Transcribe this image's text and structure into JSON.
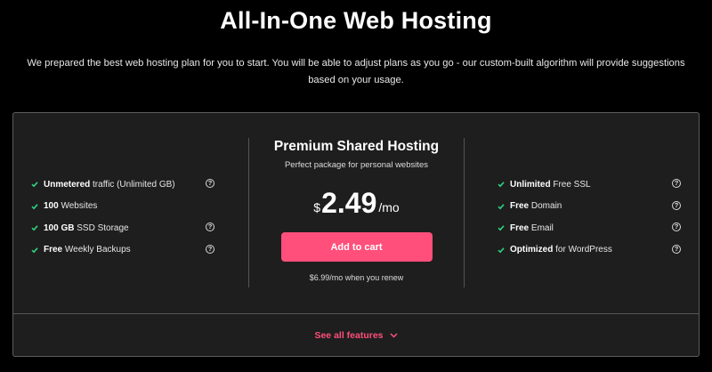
{
  "header": {
    "title": "All-In-One Web Hosting",
    "subtitle": "We prepared the best web hosting plan for you to start. You will be able to adjust plans as you go - our custom-built algorithm will provide suggestions based on your usage."
  },
  "plan": {
    "name": "Premium Shared Hosting",
    "description": "Perfect package for personal websites",
    "currency": "$",
    "price": "2.49",
    "period": "/mo",
    "cta_label": "Add to cart",
    "renew_text": "$6.99/mo when you renew"
  },
  "features_left": [
    {
      "bold": "Unmetered",
      "text": " traffic (Unlimited GB)",
      "help": true
    },
    {
      "bold": "100",
      "text": " Websites",
      "help": false
    },
    {
      "bold": "100 GB",
      "text": " SSD Storage",
      "help": true
    },
    {
      "bold": "Free",
      "text": " Weekly Backups",
      "help": true
    }
  ],
  "features_right": [
    {
      "bold": "Unlimited",
      "text": " Free SSL",
      "help": true
    },
    {
      "bold": "Free",
      "text": " Domain",
      "help": true
    },
    {
      "bold": "Free",
      "text": " Email",
      "help": true
    },
    {
      "bold": "Optimized",
      "text": " for WordPress",
      "help": true
    }
  ],
  "footer": {
    "see_all_label": "See all features"
  },
  "icons": {
    "check": "check-icon",
    "help": "help-icon",
    "chevron": "chevron-down-icon"
  },
  "colors": {
    "accent": "#ff4f7a",
    "check": "#2fd07f",
    "card_bg": "#1e1e1e",
    "page_bg": "#000000"
  }
}
